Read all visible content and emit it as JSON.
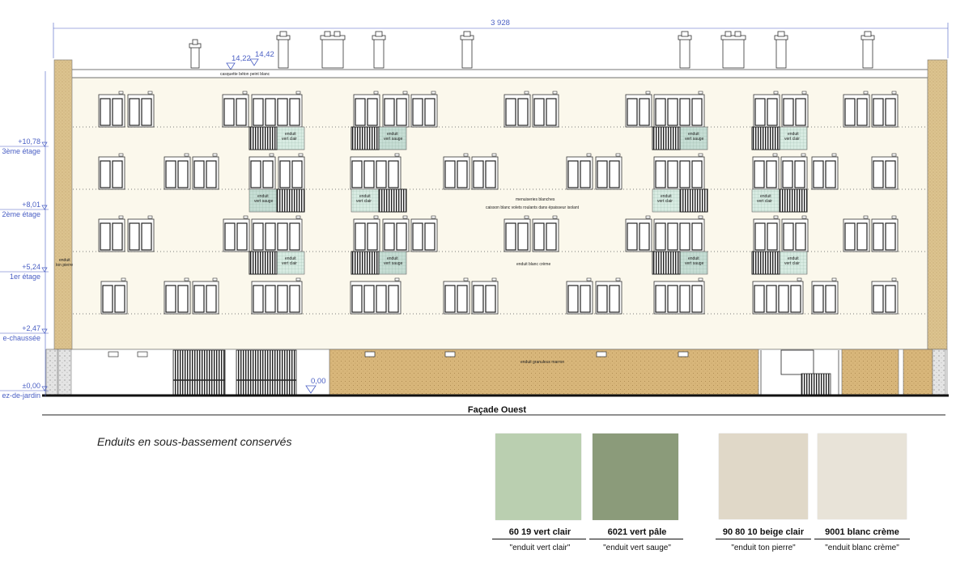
{
  "drawing": {
    "title": "Façade Ouest",
    "total_width_label": "3 928",
    "roof_elevations": [
      "14,22",
      "14,42"
    ],
    "ground_marker": "0,00",
    "levels": [
      {
        "value": "+10,78",
        "name": "3ème étage"
      },
      {
        "value": "+8,01",
        "name": "2ème étage"
      },
      {
        "value": "+5,24",
        "name": "1er étage"
      },
      {
        "value": "+2,47",
        "name": "e-chaussée"
      },
      {
        "value": "±0,00",
        "name": "ez-de-jardin"
      }
    ],
    "annotations": {
      "cornice": "casquette béton peint blanc",
      "joinery_1": "menuiseries blanches",
      "joinery_2": "caisson blanc volets roulants  dans épaisseur isolant",
      "render_cream": "enduit  blanc crème",
      "base_render": "enduit granuleux marron",
      "side_render_1": "enduit",
      "side_render_2": "ton pierre",
      "panel_light_1": "enduit",
      "panel_light_2": "vert clair",
      "panel_sage_1": "enduit",
      "panel_sage_2": "vert sauge"
    }
  },
  "note": "Enduits en sous-bassement conservés",
  "swatches": [
    {
      "name": "60 19 vert clair",
      "desc": "\"enduit vert clair\"",
      "color": "#bacfb0"
    },
    {
      "name": "6021 vert pâle",
      "desc": "\"enduit vert sauge\"",
      "color": "#8b9b7a"
    },
    {
      "name": "90 80 10 beige clair",
      "desc": "\"enduit ton pierre\"",
      "color": "#e0d8c8"
    },
    {
      "name": "9001 blanc crème",
      "desc": "\"enduit blanc crème\"",
      "color": "#e8e3d8"
    }
  ],
  "colors": {
    "facade": "#fbf8ec",
    "base": "#d8b67a",
    "pier": "#d9c08e",
    "dimension": "#4a5fc4"
  }
}
